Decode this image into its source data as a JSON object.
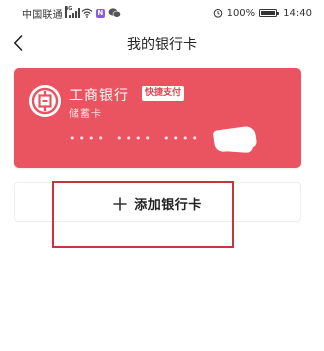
{
  "status_bar": {
    "carrier": "中国联通",
    "signal_icon": "signal-4g-icon",
    "wifi_icon": "wifi-icon",
    "app_badge": "N",
    "battery_level": "100%",
    "time": "14:40"
  },
  "nav": {
    "back_icon": "chevron-left-icon",
    "title": "我的银行卡"
  },
  "card": {
    "bank_name": "工商银行",
    "badge": "快捷支付",
    "type": "储蓄卡",
    "masked_groups": [
      "••••",
      "••••",
      "••••"
    ],
    "logo_icon": "icbc-logo-icon",
    "color": "#ea5360"
  },
  "add_card": {
    "label": "添加银行卡",
    "icon": "plus-icon"
  },
  "colors": {
    "card_red": "#ea5360",
    "highlight_red": "#c9333f"
  }
}
